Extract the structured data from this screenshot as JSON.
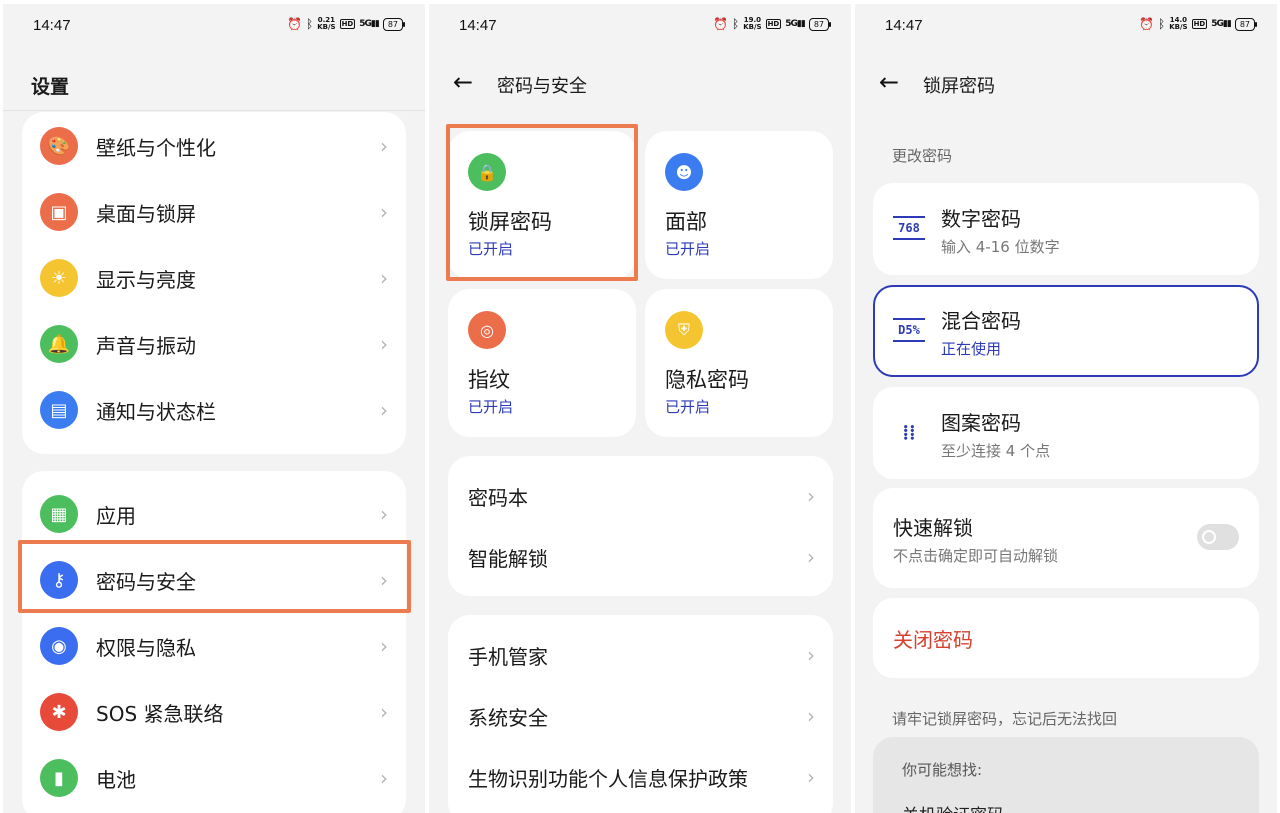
{
  "status_bar": [
    {
      "time": "14:47",
      "speed": "0.21\nKB/S",
      "hd": "HD",
      "net": "5G",
      "battery": "87"
    },
    {
      "time": "14:47",
      "speed": "19.0\nKB/S",
      "hd": "HD",
      "net": "5G",
      "battery": "87"
    },
    {
      "time": "14:47",
      "speed": "14.0\nKB/S",
      "hd": "HD",
      "net": "5G",
      "battery": "87"
    }
  ],
  "settings": {
    "title": "设置",
    "group1": [
      {
        "label": "壁纸与个性化",
        "icon": "palette-icon",
        "color": "#ec6d4a",
        "glyph": "🎨"
      },
      {
        "label": "桌面与锁屏",
        "icon": "image-icon",
        "color": "#ec6d4a",
        "glyph": "▣"
      },
      {
        "label": "显示与亮度",
        "icon": "sun-icon",
        "color": "#f5c531",
        "glyph": "☀"
      },
      {
        "label": "声音与振动",
        "icon": "bell-icon",
        "color": "#4cbe5d",
        "glyph": "🔔"
      },
      {
        "label": "通知与状态栏",
        "icon": "notification-icon",
        "color": "#3b7df1",
        "glyph": "▤"
      }
    ],
    "group2": [
      {
        "label": "应用",
        "icon": "apps-icon",
        "color": "#4cbe5d",
        "glyph": "▦"
      },
      {
        "label": "密码与安全",
        "icon": "key-icon",
        "color": "#3b6df1",
        "glyph": "⚷"
      },
      {
        "label": "权限与隐私",
        "icon": "privacy-eye-icon",
        "color": "#3b6df1",
        "glyph": "◉"
      },
      {
        "label": "SOS 紧急联络",
        "icon": "sos-icon",
        "color": "#e84a3a",
        "glyph": "✱"
      },
      {
        "label": "电池",
        "icon": "battery-icon",
        "color": "#4cbe5d",
        "glyph": "▮"
      }
    ]
  },
  "security": {
    "title": "密码与安全",
    "tiles": [
      {
        "title": "锁屏密码",
        "status": "已开启",
        "icon": "lock-icon",
        "color": "#4cbe5d",
        "glyph": "🔒"
      },
      {
        "title": "面部",
        "status": "已开启",
        "icon": "face-icon",
        "color": "#3b7df1",
        "glyph": "☻"
      },
      {
        "title": "指纹",
        "status": "已开启",
        "icon": "fingerprint-icon",
        "color": "#ec6d4a",
        "glyph": "◎"
      },
      {
        "title": "隐私密码",
        "status": "已开启",
        "icon": "shield-icon",
        "color": "#f5c531",
        "glyph": "⛨"
      }
    ],
    "group1": [
      "密码本",
      "智能解锁"
    ],
    "group2": [
      "手机管家",
      "系统安全",
      "生物识别功能个人信息保护政策"
    ]
  },
  "lockscreen": {
    "title": "锁屏密码",
    "section": "更改密码",
    "options": [
      {
        "title": "数字密码",
        "sub": "输入 4-16 位数字",
        "glyph": "768",
        "icon": "numeric-password-icon"
      },
      {
        "title": "混合密码",
        "sub": "正在使用",
        "glyph": "D5%",
        "icon": "mixed-password-icon"
      },
      {
        "title": "图案密码",
        "sub": "至少连接 4 个点",
        "glyph": "⋮⁞",
        "icon": "pattern-password-icon"
      }
    ],
    "quick_unlock": {
      "title": "快速解锁",
      "sub": "不点击确定即可自动解锁"
    },
    "close_password": "关闭密码",
    "note": "请牢记锁屏密码，忘记后无法找回",
    "suggest_title": "你可能想找:",
    "suggest_item": "关机验证密码"
  }
}
